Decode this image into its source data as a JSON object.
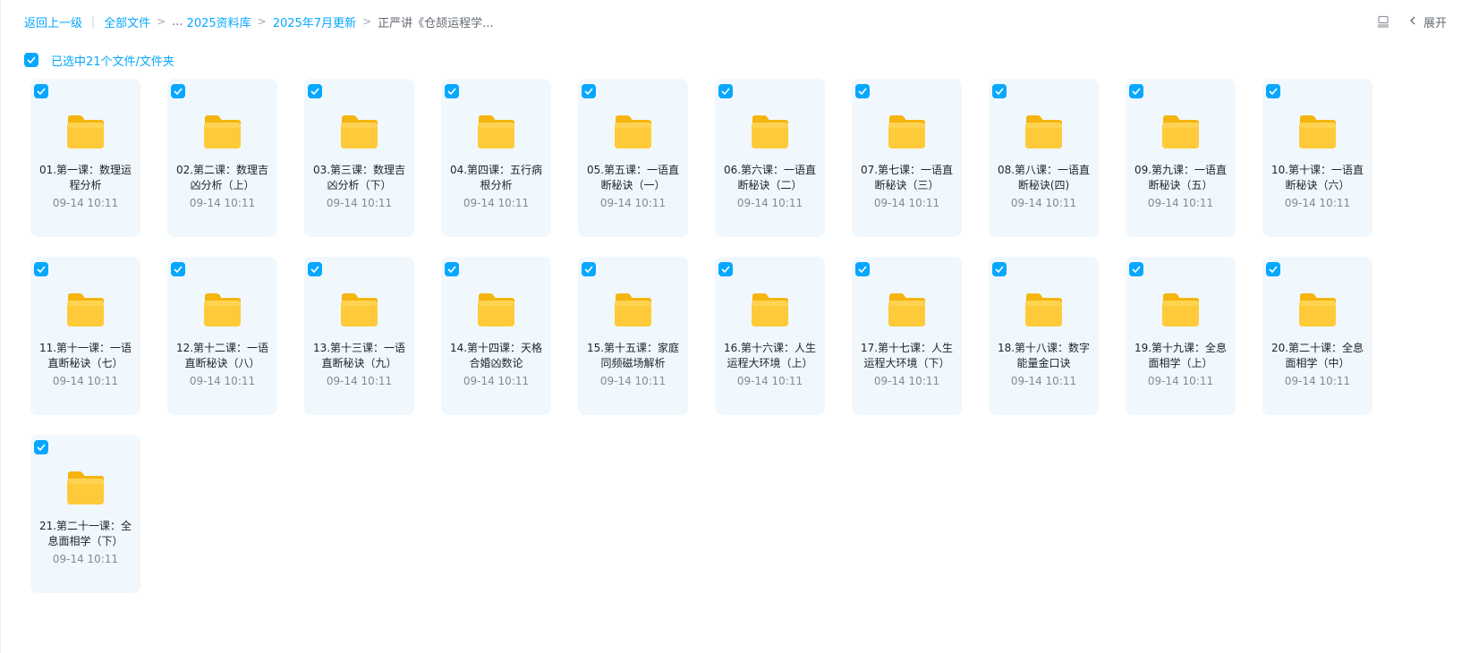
{
  "breadcrumb": {
    "back": "返回上一级",
    "all_files": "全部文件",
    "ellipsis": "...",
    "level1": "2025资料库",
    "level2": "2025年7月更新",
    "current": "正严讲《仓颉运程学..."
  },
  "toolbar": {
    "expand_label": "展开",
    "list_icon": "list-view-icon",
    "expand_icon": "chevron-left-icon"
  },
  "selection": {
    "label": "已选中21个文件/文件夹",
    "checked": true
  },
  "colors": {
    "accent": "#06a7ff",
    "card_bg": "#f0f8fd",
    "folder": "#ffc83d"
  },
  "files": [
    {
      "name": "01.第一课：数理运程分析",
      "time": "09-14 10:11",
      "icon": "folder-icon",
      "checked": true
    },
    {
      "name": "02.第二课：数理吉凶分析（上）",
      "time": "09-14 10:11",
      "icon": "folder-icon",
      "checked": true
    },
    {
      "name": "03.第三课：数理吉凶分析（下）",
      "time": "09-14 10:11",
      "icon": "folder-icon",
      "checked": true
    },
    {
      "name": "04.第四课：五行病根分析",
      "time": "09-14 10:11",
      "icon": "folder-icon",
      "checked": true
    },
    {
      "name": "05.第五课：一语直断秘诀（一）",
      "time": "09-14 10:11",
      "icon": "folder-icon",
      "checked": true
    },
    {
      "name": "06.第六课：一语直断秘诀（二）",
      "time": "09-14 10:11",
      "icon": "folder-icon",
      "checked": true
    },
    {
      "name": "07.第七课：一语直断秘诀（三）",
      "time": "09-14 10:11",
      "icon": "folder-icon",
      "checked": true
    },
    {
      "name": "08.第八课：一语直断秘诀(四)",
      "time": "09-14 10:11",
      "icon": "folder-icon",
      "checked": true
    },
    {
      "name": "09.第九课：一语直断秘诀（五）",
      "time": "09-14 10:11",
      "icon": "folder-icon",
      "checked": true
    },
    {
      "name": "10.第十课：一语直断秘诀（六）",
      "time": "09-14 10:11",
      "icon": "folder-icon",
      "checked": true
    },
    {
      "name": "11.第十一课：一语直断秘诀（七）",
      "time": "09-14 10:11",
      "icon": "folder-icon",
      "checked": true
    },
    {
      "name": "12.第十二课：一语直断秘诀（八）",
      "time": "09-14 10:11",
      "icon": "folder-icon",
      "checked": true
    },
    {
      "name": "13.第十三课：一语直断秘诀（九）",
      "time": "09-14 10:11",
      "icon": "folder-icon",
      "checked": true
    },
    {
      "name": "14.第十四课：天格合婚凶数论",
      "time": "09-14 10:11",
      "icon": "folder-icon",
      "checked": true
    },
    {
      "name": "15.第十五课：家庭同频磁场解析",
      "time": "09-14 10:11",
      "icon": "folder-icon",
      "checked": true
    },
    {
      "name": "16.第十六课：人生运程大环境（上）",
      "time": "09-14 10:11",
      "icon": "folder-icon",
      "checked": true
    },
    {
      "name": "17.第十七课：人生运程大环境（下）",
      "time": "09-14 10:11",
      "icon": "folder-icon",
      "checked": true
    },
    {
      "name": "18.第十八课：数字能量金口诀",
      "time": "09-14 10:11",
      "icon": "folder-icon",
      "checked": true
    },
    {
      "name": "19.第十九课：全息面相学（上）",
      "time": "09-14 10:11",
      "icon": "folder-icon",
      "checked": true
    },
    {
      "name": "20.第二十课：全息面相学（中）",
      "time": "09-14 10:11",
      "icon": "folder-icon",
      "checked": true
    },
    {
      "name": "21.第二十一课：全息面相学（下）",
      "time": "09-14 10:11",
      "icon": "folder-icon",
      "checked": true
    }
  ]
}
